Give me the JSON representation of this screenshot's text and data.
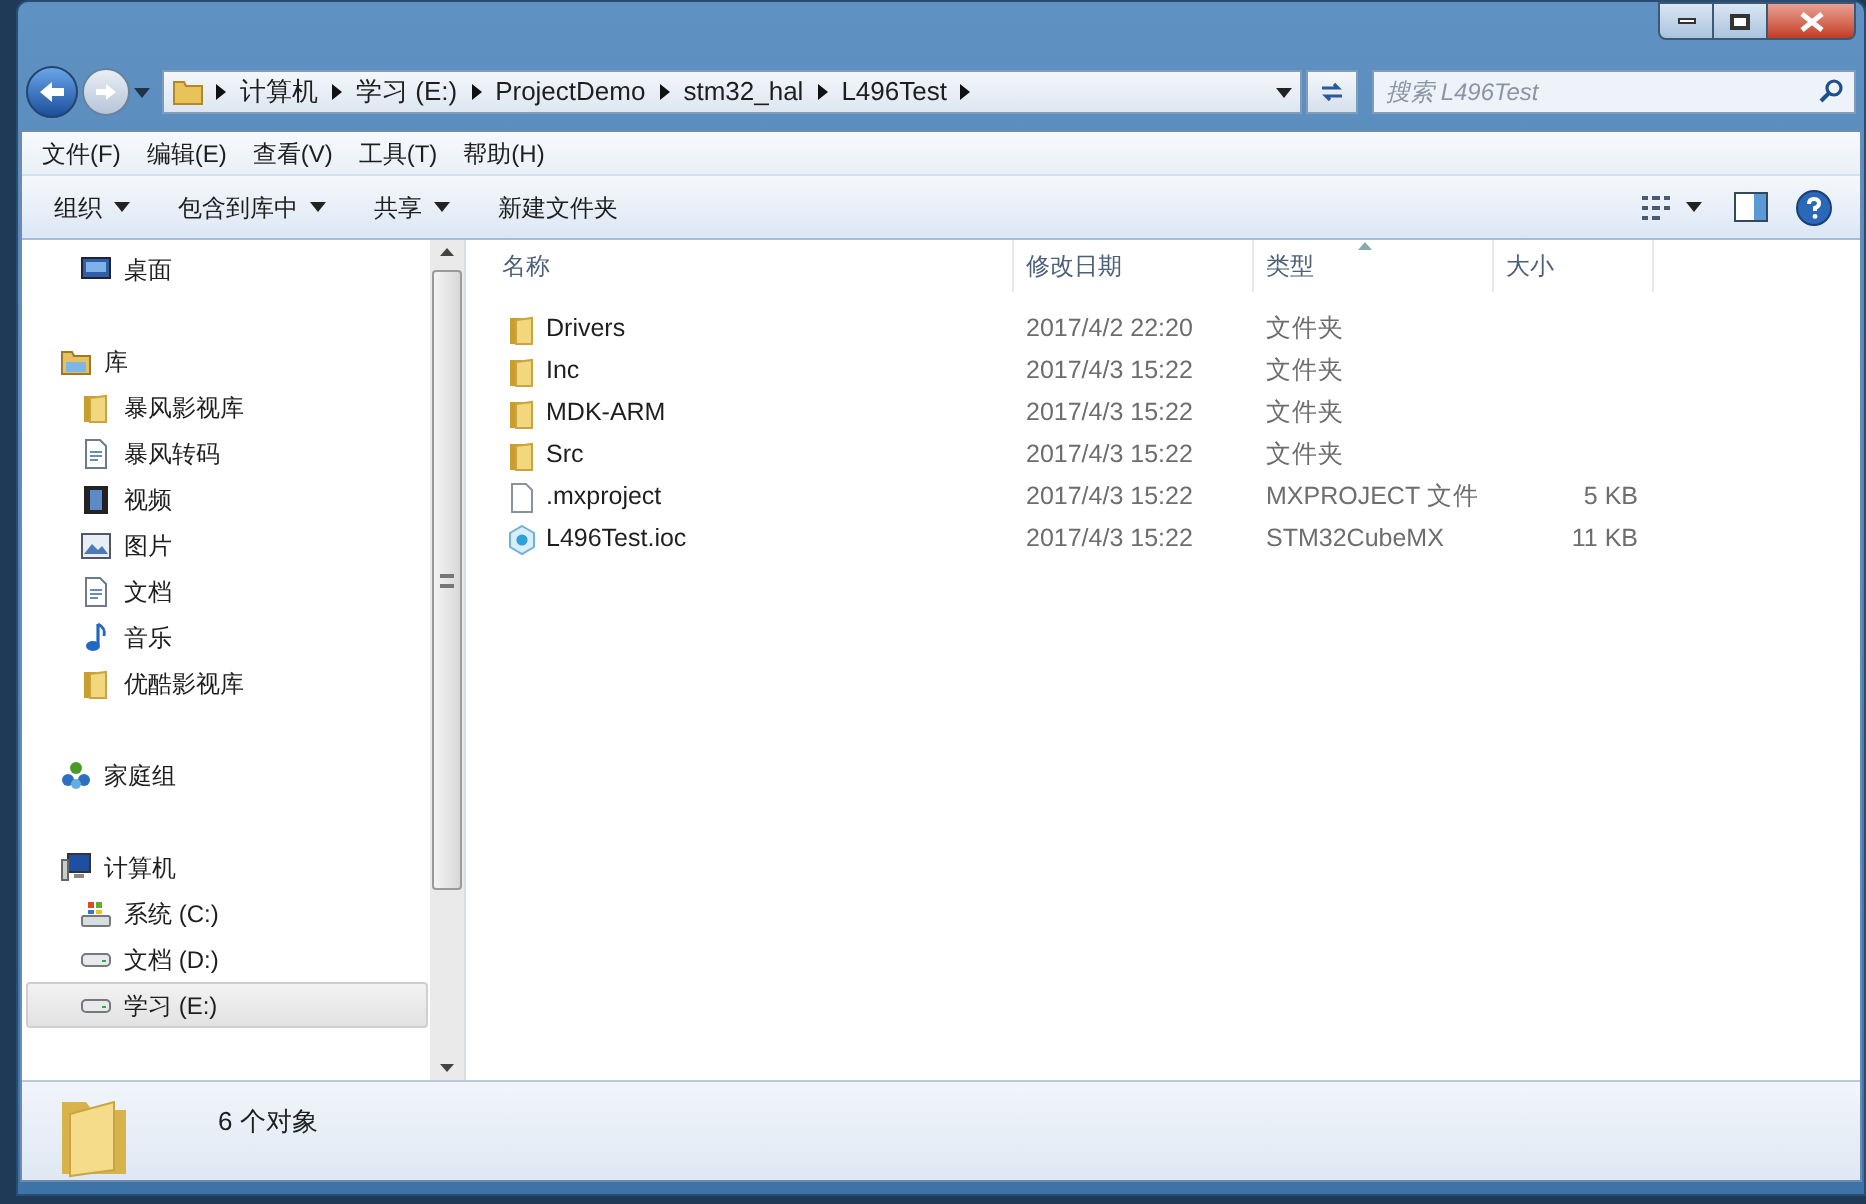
{
  "address": {
    "segments": [
      "计算机",
      "学习 (E:)",
      "ProjectDemo",
      "stm32_hal",
      "L496Test"
    ]
  },
  "search": {
    "placeholder": "搜索 L496Test"
  },
  "menu": [
    "文件(F)",
    "编辑(E)",
    "查看(V)",
    "工具(T)",
    "帮助(H)"
  ],
  "toolbar": [
    {
      "label": "组织",
      "has_menu": true
    },
    {
      "label": "包含到库中",
      "has_menu": true
    },
    {
      "label": "共享",
      "has_menu": true
    },
    {
      "label": "新建文件夹",
      "has_menu": false
    }
  ],
  "nav": [
    {
      "children": [
        {
          "label": "桌面",
          "kind": "desktop",
          "selected": false
        }
      ]
    },
    {
      "label": "库",
      "kind": "library",
      "selected": false,
      "children": [
        {
          "label": "暴风影视库",
          "kind": "folder",
          "selected": false
        },
        {
          "label": "暴风转码",
          "kind": "doc",
          "selected": false
        },
        {
          "label": "视频",
          "kind": "video",
          "selected": false
        },
        {
          "label": "图片",
          "kind": "image",
          "selected": false
        },
        {
          "label": "文档",
          "kind": "doc",
          "selected": false
        },
        {
          "label": "音乐",
          "kind": "music",
          "selected": false
        },
        {
          "label": "优酷影视库",
          "kind": "folder",
          "selected": false
        }
      ]
    },
    {
      "label": "家庭组",
      "kind": "homegroup",
      "selected": false
    },
    {
      "label": "计算机",
      "kind": "computer",
      "selected": false,
      "children": [
        {
          "label": "系统 (C:)",
          "kind": "sysdrive",
          "selected": false
        },
        {
          "label": "文档 (D:)",
          "kind": "drive",
          "selected": false
        },
        {
          "label": "学习 (E:)",
          "kind": "drive",
          "selected": true
        }
      ]
    }
  ],
  "files": {
    "columns": [
      {
        "label": "名称",
        "sorted": false
      },
      {
        "label": "修改日期",
        "sorted": false
      },
      {
        "label": "类型",
        "sorted": true
      },
      {
        "label": "大小",
        "sorted": false
      }
    ],
    "rows": [
      {
        "name": "Drivers",
        "date": "2017/4/2 22:20",
        "type": "文件夹",
        "kind": "folder"
      },
      {
        "name": "Inc",
        "date": "2017/4/3 15:22",
        "type": "文件夹",
        "kind": "folder"
      },
      {
        "name": "MDK-ARM",
        "date": "2017/4/3 15:22",
        "type": "文件夹",
        "kind": "folder"
      },
      {
        "name": "Src",
        "date": "2017/4/3 15:22",
        "type": "文件夹",
        "kind": "folder"
      },
      {
        "name": ".mxproject",
        "date": "2017/4/3 15:22",
        "type": "MXPROJECT 文件",
        "size": "5 KB",
        "kind": "file"
      },
      {
        "name": "L496Test.ioc",
        "date": "2017/4/3 15:22",
        "type": "STM32CubeMX",
        "size": "11 KB",
        "kind": "cube"
      }
    ]
  },
  "status_bar": {
    "count": "6 个对象"
  }
}
